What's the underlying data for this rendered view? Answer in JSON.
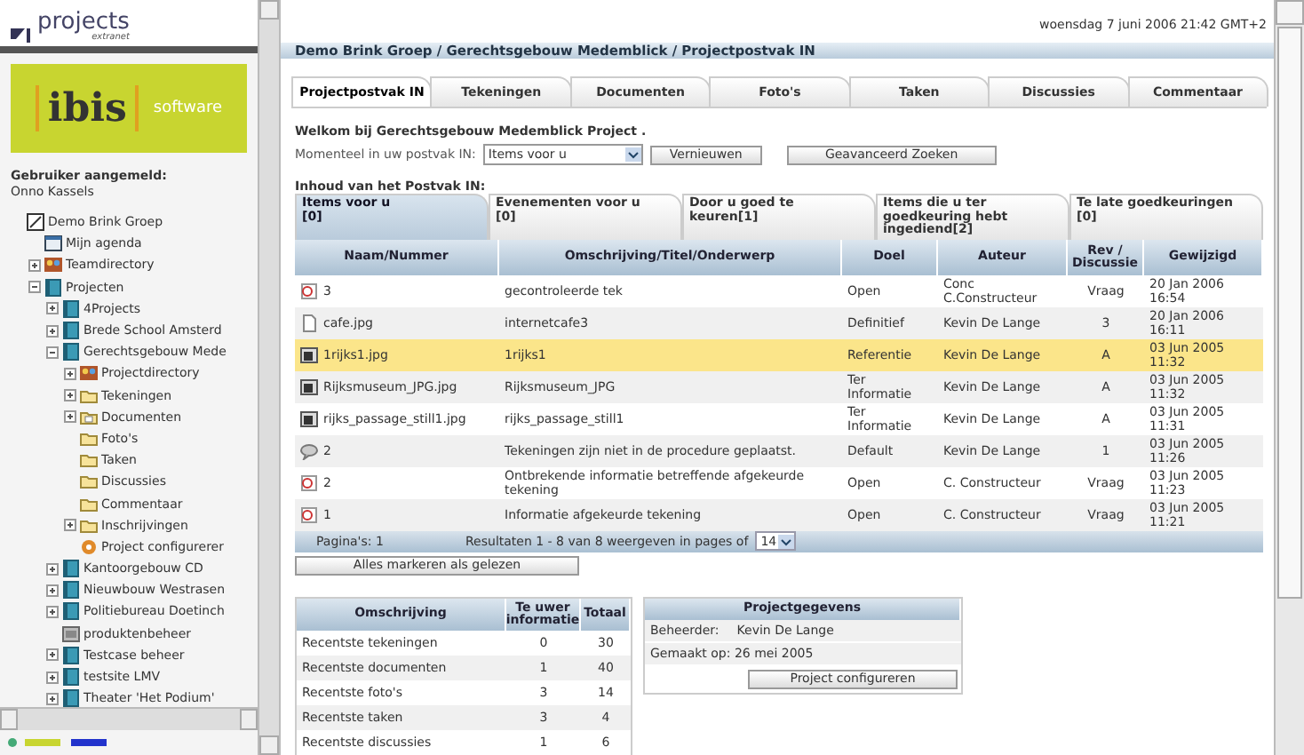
{
  "sidebar": {
    "logo": {
      "name": "projects",
      "sub": "extranet"
    },
    "brand": {
      "name": "ibis",
      "sub": "software"
    },
    "user_label": "Gebruiker aangemeld:",
    "user_name": "Onno Kassels",
    "tree": [
      {
        "label": "Demo Brink Groep",
        "kind": "root",
        "children": [
          {
            "label": "Mijn agenda",
            "kind": "calendar"
          },
          {
            "label": "Teamdirectory",
            "kind": "team",
            "expanded": false
          },
          {
            "label": "Projecten",
            "kind": "project",
            "expanded": true,
            "children": [
              {
                "label": "4Projects",
                "kind": "project",
                "expanded": false
              },
              {
                "label": "Brede School Amsterd",
                "kind": "project",
                "expanded": false
              },
              {
                "label": "Gerechtsgebouw Mede",
                "kind": "project",
                "expanded": true,
                "children": [
                  {
                    "label": "Projectdirectory",
                    "kind": "team",
                    "expanded": false
                  },
                  {
                    "label": "Tekeningen",
                    "kind": "folder",
                    "expanded": false
                  },
                  {
                    "label": "Documenten",
                    "kind": "docfolder",
                    "expanded": false
                  },
                  {
                    "label": "Foto's",
                    "kind": "folder"
                  },
                  {
                    "label": "Taken",
                    "kind": "folder"
                  },
                  {
                    "label": "Discussies",
                    "kind": "folder"
                  },
                  {
                    "label": "Commentaar",
                    "kind": "folder"
                  },
                  {
                    "label": "Inschrijvingen",
                    "kind": "folder",
                    "expanded": false
                  },
                  {
                    "label": "Project configurerer",
                    "kind": "config"
                  }
                ]
              },
              {
                "label": "Kantoorgebouw CD",
                "kind": "project",
                "expanded": false
              },
              {
                "label": "Nieuwbouw Westrasen",
                "kind": "project",
                "expanded": false
              },
              {
                "label": "Politiebureau Doetinch",
                "kind": "project",
                "expanded": false
              },
              {
                "label": "produktenbeheer",
                "kind": "module"
              },
              {
                "label": "Testcase beheer",
                "kind": "project",
                "expanded": false
              },
              {
                "label": "testsite LMV",
                "kind": "project",
                "expanded": false
              },
              {
                "label": "Theater 'Het Podium'",
                "kind": "project",
                "expanded": false
              }
            ]
          }
        ]
      }
    ]
  },
  "datetime": "woensdag 7 juni 2006 21:42 GMT+2",
  "breadcrumb": "Demo Brink Groep / Gerechtsgebouw Medemblick / Projectpostvak IN",
  "tabs": [
    {
      "label": "Projectpostvak IN",
      "selected": true
    },
    {
      "label": "Tekeningen",
      "selected": false
    },
    {
      "label": "Documenten",
      "selected": false
    },
    {
      "label": "Foto's",
      "selected": false
    },
    {
      "label": "Taken",
      "selected": false
    },
    {
      "label": "Discussies",
      "selected": false
    },
    {
      "label": "Commentaar",
      "selected": false
    }
  ],
  "welcome": "Welkom bij Gerechtsgebouw Medemblick Project .",
  "filter": {
    "label": "Momenteel in uw postvak IN:",
    "value": "Items voor u",
    "refresh": "Vernieuwen",
    "advanced": "Geavanceerd Zoeken"
  },
  "inbox_title": "Inhoud van het Postvak IN:",
  "subtabs": [
    {
      "label": "Items voor u",
      "count": "[0]",
      "selected": true
    },
    {
      "label": "Evenementen voor u",
      "count": "[0]",
      "selected": false
    },
    {
      "label": "Door u goed te",
      "count": "keuren[1]",
      "selected": false
    },
    {
      "label": "Items die u ter goedkeuring hebt",
      "count": "ingediend[2]",
      "selected": false
    },
    {
      "label": "Te late goedkeuringen",
      "count": "[0]",
      "selected": false
    }
  ],
  "table": {
    "columns": [
      "Naam/Nummer",
      "Omschrijving/Titel/Onderwerp",
      "Doel",
      "Auteur",
      "Rev / Discussie",
      "Gewijzigd"
    ],
    "rows": [
      {
        "kind": "drawing",
        "name": "3",
        "title": "gecontroleerde tek",
        "goal": "Open",
        "author": "Conc C.Constructeur",
        "rev": "Vraag",
        "date": "20 Jan 2006 16:54",
        "selected": false
      },
      {
        "kind": "file",
        "name": "cafe.jpg",
        "title": "internetcafe3",
        "goal": "Definitief",
        "author": "Kevin De Lange",
        "rev": "3",
        "date": "20 Jan 2006 16:11",
        "selected": false
      },
      {
        "kind": "image",
        "name": "1rijks1.jpg",
        "title": "1rijks1",
        "goal": "Referentie",
        "author": "Kevin De Lange",
        "rev": "A",
        "date": "03 Jun 2005 11:32",
        "selected": true
      },
      {
        "kind": "image",
        "name": "Rijksmuseum_JPG.jpg",
        "title": "Rijksmuseum_JPG",
        "goal": "Ter Informatie",
        "author": "Kevin De Lange",
        "rev": "A",
        "date": "03 Jun 2005 11:32",
        "selected": false
      },
      {
        "kind": "image",
        "name": "rijks_passage_still1.jpg",
        "title": "rijks_passage_still1",
        "goal": "Ter Informatie",
        "author": "Kevin De Lange",
        "rev": "A",
        "date": "03 Jun 2005 11:31",
        "selected": false
      },
      {
        "kind": "discussion",
        "name": "2",
        "title": "Tekeningen zijn niet in de procedure geplaatst.",
        "goal": "Default",
        "author": "Kevin De Lange",
        "rev": "1",
        "date": "03 Jun 2005 11:26",
        "selected": false
      },
      {
        "kind": "drawing",
        "name": "2",
        "title": "Ontbrekende informatie betreffende afgekeurde tekening",
        "goal": "Open",
        "author": "C. Constructeur",
        "rev": "Vraag",
        "date": "03 Jun 2005 11:23",
        "selected": false
      },
      {
        "kind": "drawing",
        "name": "1",
        "title": "Informatie afgekeurde tekening",
        "goal": "Open",
        "author": "C. Constructeur",
        "rev": "Vraag",
        "date": "03 Jun 2005 11:21",
        "selected": false
      }
    ]
  },
  "pager": {
    "pages": "Pagina's: 1",
    "results": "Resultaten 1 - 8 van 8 weergeven in pages of",
    "per_page": "14"
  },
  "mark_all": "Alles markeren als gelezen",
  "summary": {
    "columns": [
      "Omschrijving",
      "Te uwer informatie",
      "Totaal"
    ],
    "rows": [
      [
        "Recentste tekeningen",
        "0",
        "30"
      ],
      [
        "Recentste documenten",
        "1",
        "40"
      ],
      [
        "Recentste foto's",
        "3",
        "14"
      ],
      [
        "Recentste taken",
        "3",
        "4"
      ],
      [
        "Recentste discussies",
        "1",
        "6"
      ]
    ]
  },
  "project_info": {
    "title": "Projectgegevens",
    "manager_label": "Beheerder:",
    "manager": "Kevin De Lange",
    "created": "Gemaakt op: 26 mei 2005",
    "configure": "Project configureren"
  }
}
